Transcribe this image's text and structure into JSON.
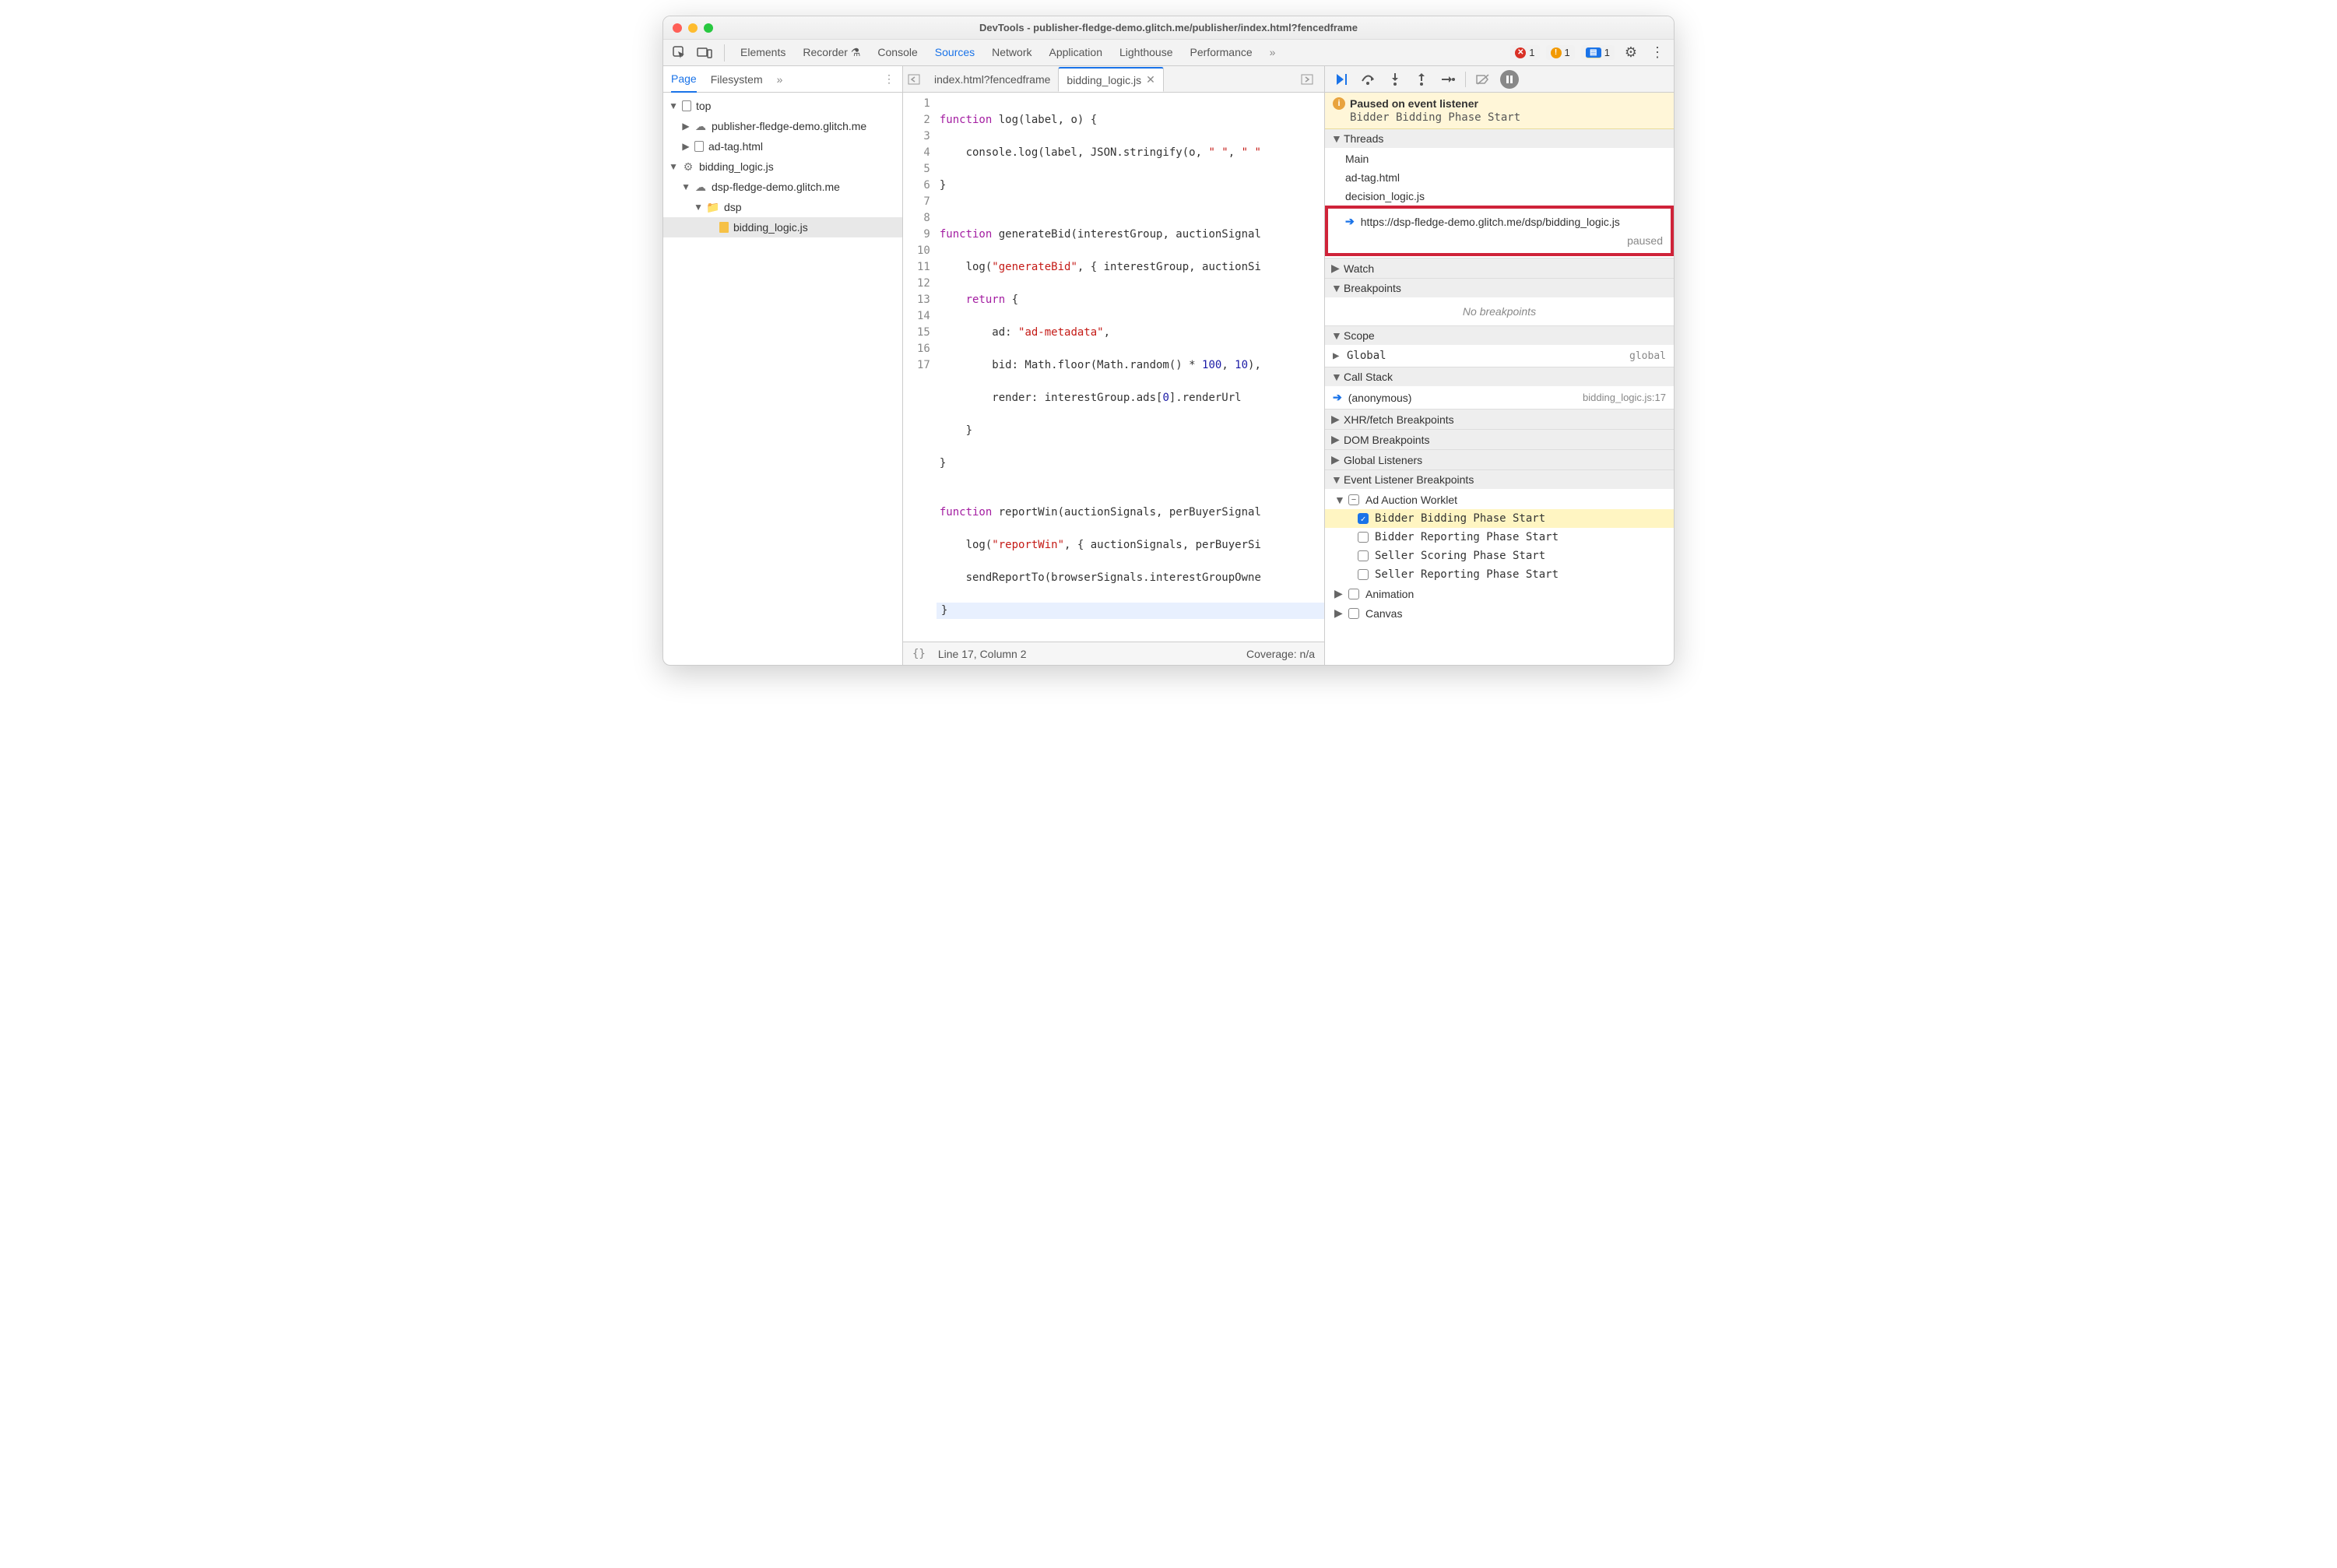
{
  "title": "DevTools - publisher-fledge-demo.glitch.me/publisher/index.html?fencedframe",
  "topTabs": [
    "Elements",
    "Recorder",
    "Console",
    "Sources",
    "Network",
    "Application",
    "Lighthouse",
    "Performance"
  ],
  "topTabsActive": "Sources",
  "counts": {
    "errors": "1",
    "warnings": "1",
    "messages": "1"
  },
  "navSubTabs": [
    "Page",
    "Filesystem"
  ],
  "navSubActive": "Page",
  "tree": {
    "top": "top",
    "pub": "publisher-fledge-demo.glitch.me",
    "adtag": "ad-tag.html",
    "bidding": "bidding_logic.js",
    "dsp": "dsp-fledge-demo.glitch.me",
    "dspFolder": "dsp",
    "bidFile": "bidding_logic.js"
  },
  "editorTabs": [
    "index.html?fencedframe",
    "bidding_logic.js"
  ],
  "editorActive": "bidding_logic.js",
  "code": {
    "lines": 17,
    "l1": "function log(label, o) {",
    "l2": "    console.log(label, JSON.stringify(o, \" \", \" \"",
    "l3": "}",
    "l4": "",
    "l5": "function generateBid(interestGroup, auctionSignal",
    "l6": "    log(\"generateBid\", { interestGroup, auctionSi",
    "l7": "    return {",
    "l8": "        ad: \"ad-metadata\",",
    "l9": "        bid: Math.floor(Math.random() * 100, 10),",
    "l10": "        render: interestGroup.ads[0].renderUrl",
    "l11": "    }",
    "l12": "}",
    "l13": "",
    "l14": "function reportWin(auctionSignals, perBuyerSignal",
    "l15": "    log(\"reportWin\", { auctionSignals, perBuyerSi",
    "l16": "    sendReportTo(browserSignals.interestGroupOwne",
    "l17": "}"
  },
  "status": {
    "line": "Line 17, Column 2",
    "coverage": "Coverage: n/a"
  },
  "paused": {
    "title": "Paused on event listener",
    "sub": "Bidder Bidding Phase Start"
  },
  "threads": {
    "title": "Threads",
    "items": [
      "Main",
      "ad-tag.html",
      "decision_logic.js"
    ],
    "hlUrl": "https://dsp-fledge-demo.glitch.me/dsp/bidding_logic.js",
    "hlStatus": "paused"
  },
  "watch": "Watch",
  "breakpoints": {
    "title": "Breakpoints",
    "empty": "No breakpoints"
  },
  "scope": {
    "title": "Scope",
    "global": "Global",
    "globalVal": "global"
  },
  "callstack": {
    "title": "Call Stack",
    "frame": "(anonymous)",
    "loc": "bidding_logic.js:17"
  },
  "xhrbp": "XHR/fetch Breakpoints",
  "dombp": "DOM Breakpoints",
  "globlis": "Global Listeners",
  "evbp": {
    "title": "Event Listener Breakpoints",
    "group": "Ad Auction Worklet",
    "items": [
      {
        "label": "Bidder Bidding Phase Start",
        "checked": true
      },
      {
        "label": "Bidder Reporting Phase Start",
        "checked": false
      },
      {
        "label": "Seller Scoring Phase Start",
        "checked": false
      },
      {
        "label": "Seller Reporting Phase Start",
        "checked": false
      }
    ],
    "animation": "Animation",
    "canvas": "Canvas"
  }
}
